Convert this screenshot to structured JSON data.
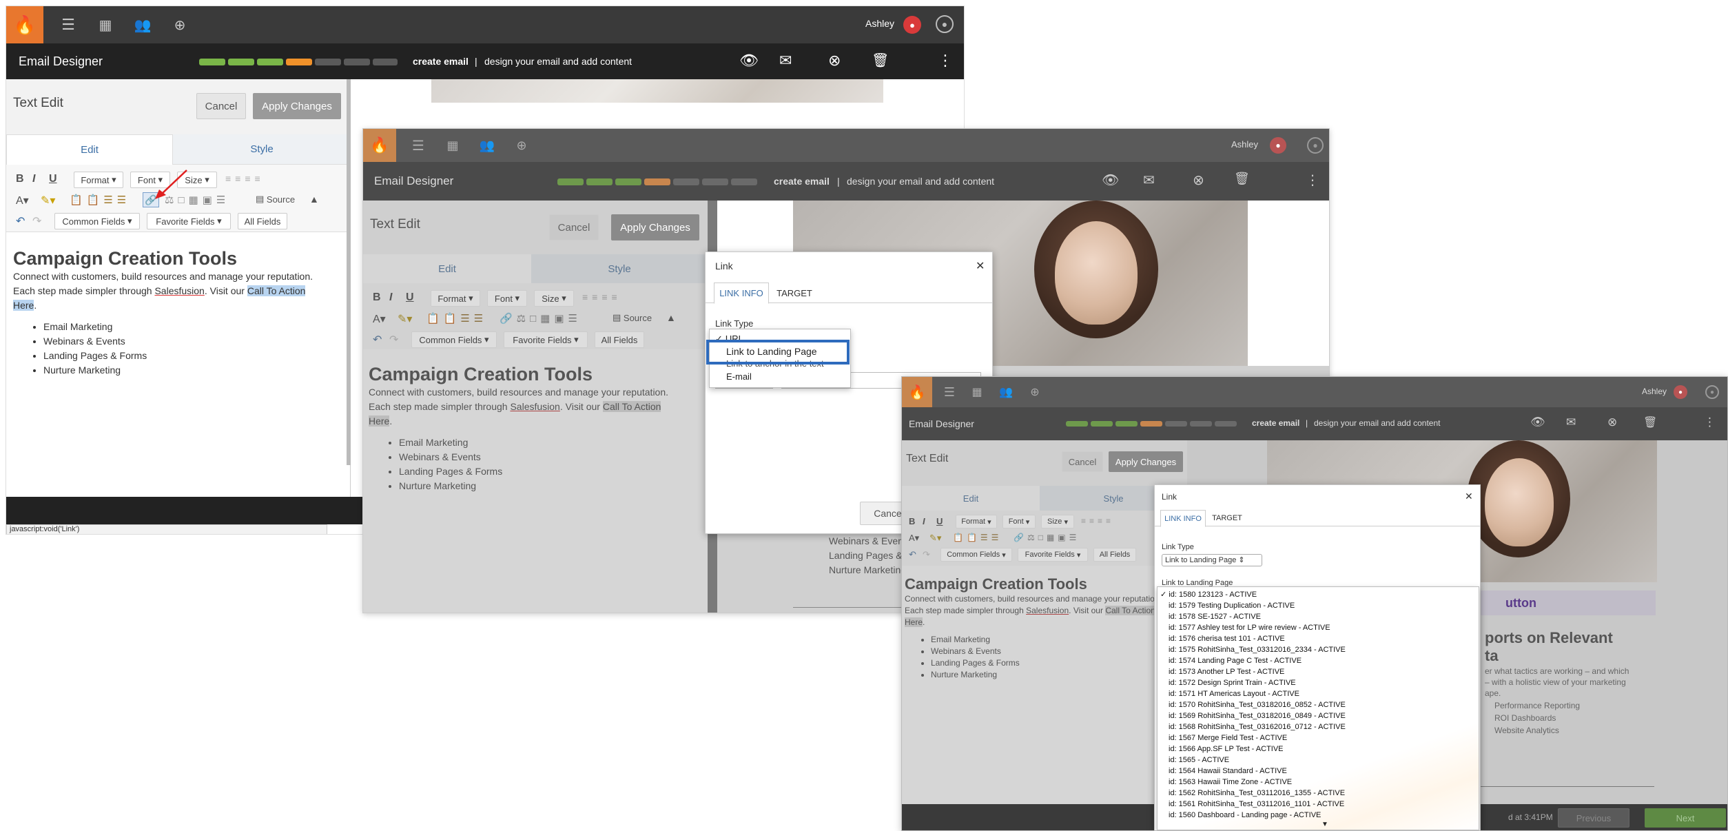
{
  "header": {
    "user_name": "Ashley",
    "logo_icon": "flame-icon"
  },
  "designer": {
    "title": "Email Designer",
    "step_current": "create email",
    "step_separator": "|",
    "step_description": "design your email and add content",
    "progress_colors": [
      "#7ab648",
      "#7ab648",
      "#7ab648",
      "#f0912a",
      "#5a5a5a",
      "#5a5a5a",
      "#5a5a5a"
    ]
  },
  "panel": {
    "title": "Text Edit",
    "cancel_label": "Cancel",
    "apply_label": "Apply Changes",
    "tab_edit": "Edit",
    "tab_style": "Style"
  },
  "toolbar": {
    "format": "Format",
    "font": "Font",
    "size": "Size",
    "source": "Source",
    "common_fields": "Common Fields",
    "favorite_fields": "Favorite Fields",
    "all_fields": "All Fields"
  },
  "content": {
    "heading": "Campaign Creation Tools",
    "para_1": "Connect with customers, build resources and manage your reputation.",
    "para_2_prefix": "Each step made simpler through",
    "para_2_brand": "Salesfusion",
    "para_2_mid": ". Visit our",
    "para_2_link_1": "Call To Action",
    "para_2_link_2": "Here",
    "bullets": [
      "Email Marketing",
      "Webinars & Events",
      "Landing Pages & Forms",
      "Nurture Marketing"
    ]
  },
  "statusbar": {
    "url": "javascript:void('Link')"
  },
  "link_dialog": {
    "title": "Link",
    "tab_link_info": "LINK INFO",
    "tab_target": "TARGET",
    "link_type_label": "Link Type",
    "link_type_options": [
      "URL",
      "Link to Landing Page",
      "Link to anchor in the text",
      "E-mail"
    ],
    "cancel_label": "Cancel"
  },
  "link_dialog_3": {
    "link_type_value": "Link to Landing Page",
    "landing_label": "Link to Landing Page",
    "landing_pages": [
      "id: 1580 123123 - ACTIVE",
      "id: 1579 Testing Duplication - ACTIVE",
      "id: 1578 SE-1527 - ACTIVE",
      "id: 1577 Ashley test for LP wire review - ACTIVE",
      "id: 1576 cherisa test 101 - ACTIVE",
      "id: 1575 RohitSinha_Test_03312016_2334 - ACTIVE",
      "id: 1574 Landing Page C Test - ACTIVE",
      "id: 1573 Another LP Test - ACTIVE",
      "id: 1572 Design Sprint Train - ACTIVE",
      "id: 1571 HT Americas Layout - ACTIVE",
      "id: 1570 RohitSinha_Test_03182016_0852 - ACTIVE",
      "id: 1569 RohitSinha_Test_03182016_0849 - ACTIVE",
      "id: 1568 RohitSinha_Test_03162016_0712 - ACTIVE",
      "id: 1567 Merge Field Test - ACTIVE",
      "id: 1566 App.SF LP Test - ACTIVE",
      "id: 1565 - ACTIVE",
      "id: 1564 Hawaii Standard - ACTIVE",
      "id: 1563 Hawaii Time Zone - ACTIVE",
      "id: 1562 RohitSinha_Test_03112016_1355 - ACTIVE",
      "id: 1561 RohitSinha_Test_03112016_1101 - ACTIVE",
      "id: 1560 Dashboard - Landing page - ACTIVE"
    ]
  },
  "email_preview": {
    "button_text": "utton",
    "heading_1": "ports on Relevant",
    "heading_2": "ta",
    "body_1": "er what tactics are working – and which",
    "body_2": "– with a holistic view of your marketing",
    "body_3": "ape.",
    "bullets": [
      "Performance Reporting",
      "ROI Dashboards",
      "Website Analytics"
    ]
  },
  "footer_3": {
    "saved_text": "d at 3:41PM",
    "previous_label": "Previous",
    "next_label": "Next"
  }
}
